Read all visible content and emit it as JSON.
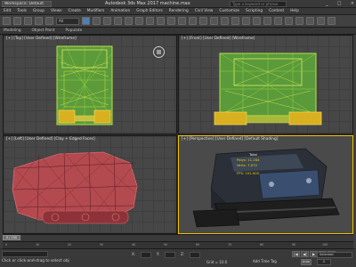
{
  "titlebar": {
    "workspace": "Workspace: Default",
    "app_title": "Autodesk 3ds Max 2017     machine.max",
    "search_placeholder": "Type a keyword or phrase",
    "min": "_",
    "max": "□",
    "close": "×"
  },
  "menubar": [
    "Edit",
    "Tools",
    "Group",
    "Views",
    "Create",
    "Modifiers",
    "Animation",
    "Graph Editors",
    "Rendering",
    "Civil View",
    "Customize",
    "Scripting",
    "Content",
    "Help"
  ],
  "toolbar": {
    "selection_filter": "All"
  },
  "ribbon": [
    "Modeling",
    "Object Paint",
    "Populate"
  ],
  "viewports": {
    "top_left": "[+] [Top] [User Defined] [Wireframe]",
    "top_right": "[+] [Front] [User Defined] [Wireframe]",
    "bottom_left": "[+] [Left] [User Defined] [Clay + Edged Faces]",
    "bottom_right": "[+] [Perspective] [User Defined] [Default Shading]"
  },
  "stats": {
    "header": "Total",
    "polys_label": "Polys:",
    "polys": "11,284",
    "verts_label": "Verts:",
    "verts": "7,972",
    "fps_label": "FPS:",
    "fps": "101.905"
  },
  "timeline": {
    "position": "0 / 100",
    "ticks": [
      "0",
      "10",
      "20",
      "30",
      "40",
      "50",
      "60",
      "70",
      "80",
      "90",
      "100"
    ]
  },
  "status": {
    "prompt": "Click or click-and-drag to select obj",
    "x": "X:",
    "y": "Y:",
    "z": "Z:",
    "grid": "Grid = 10.0",
    "add_time_tag": "Add Time Tag",
    "auto_key": "Auto",
    "selected_set": "Selected",
    "frame": "0"
  },
  "colors": {
    "accent_yellow": "#f0c000",
    "wire_green": "#7ec63a",
    "wire_red": "#b8464e",
    "stats_yellow": "#f0d000"
  }
}
